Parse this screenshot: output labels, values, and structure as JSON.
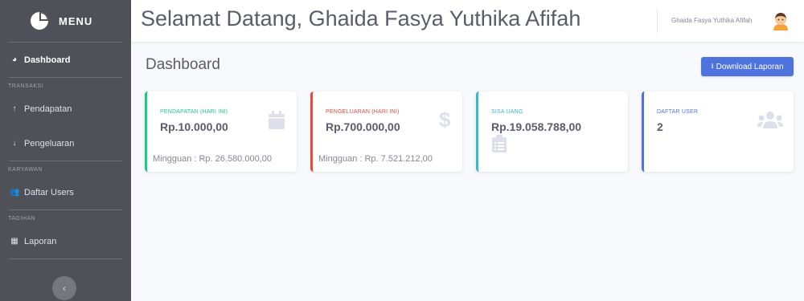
{
  "sidebar": {
    "brand": "MENU",
    "items": [
      {
        "label": "Dashboard",
        "icon": "dashboard-icon"
      },
      {
        "heading": "TRANSAKSI"
      },
      {
        "label": "Pendapatan",
        "icon": "arrow-up-icon"
      },
      {
        "label": "Pengeluaran",
        "icon": "arrow-down-icon"
      },
      {
        "heading": "KARYAWAN"
      },
      {
        "label": "Daftar Users",
        "icon": "users-icon"
      },
      {
        "heading": "TAGIHAN"
      },
      {
        "label": "Laporan",
        "icon": "table-icon"
      }
    ],
    "toggle": "‹"
  },
  "topbar": {
    "welcome": "Selamat Datang, Ghaida Fasya Yuthika Afifah",
    "user_name": "Ghaida Fasya Yuthika Afifah"
  },
  "page": {
    "title": "Dashboard",
    "download_button": "Download Laporan"
  },
  "cards": [
    {
      "label": "PENDAPATAN (HARI INI)",
      "value": "Rp.10.000,00",
      "sub": "Mingguan : Rp. 26.580.000,00",
      "icon": "calendar-icon",
      "color": "#1cc88a"
    },
    {
      "label": "PENGELUARAN (HARI INI)",
      "value": "Rp.700.000,00",
      "sub": "Mingguan : Rp. 7.521.212,00",
      "icon": "dollar-icon",
      "color": "#e74a3b"
    },
    {
      "label": "SISA UANG",
      "value": "Rp.19.058.788,00",
      "icon": "clipboard-list-icon",
      "color": "#36b9cc"
    },
    {
      "label": "DAFTAR USER",
      "value": "2",
      "icon": "users-icon",
      "color": "#4e73df"
    }
  ]
}
